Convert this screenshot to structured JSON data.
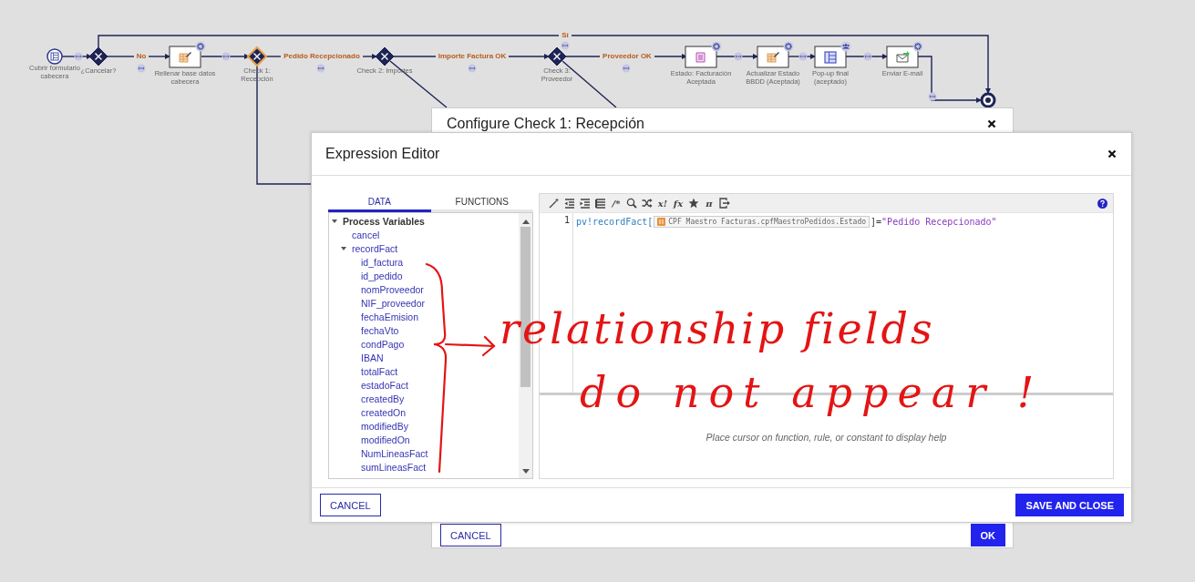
{
  "diagram": {
    "nodes": [
      {
        "kind": "start",
        "label": [
          "Cubrir formulario",
          "cabecera"
        ],
        "selected": false
      },
      {
        "kind": "gateway",
        "label": [
          "¿Cancelar?"
        ],
        "selected": false
      },
      {
        "kind": "task",
        "label": [
          "Rellenar base datos",
          "cabecera"
        ],
        "selected": false
      },
      {
        "kind": "gateway",
        "label": [
          "Check 1:",
          "Recepción"
        ],
        "selected": true
      },
      {
        "kind": "gateway",
        "label": [
          "Check 2: Importes"
        ],
        "selected": false
      },
      {
        "kind": "gateway",
        "label": [
          "Check 3:",
          "Proveedor"
        ],
        "selected": false
      },
      {
        "kind": "task",
        "label": [
          "Estado: Facturación",
          "Aceptada"
        ],
        "selected": false
      },
      {
        "kind": "task",
        "label": [
          "Actualizar Estado",
          "BBDD (Aceptada)"
        ],
        "selected": false
      },
      {
        "kind": "task",
        "label": [
          "Pop-up final",
          "(aceptado)"
        ],
        "selected": false
      },
      {
        "kind": "task",
        "label": [
          "Enviar E-mail"
        ],
        "selected": false
      },
      {
        "kind": "end",
        "selected": false
      }
    ],
    "flow_labels": [
      "Sí",
      "No",
      "Pedido Recepcionado",
      "Importe Factura OK",
      "Proveedor OK"
    ]
  },
  "configure_dialog": {
    "title": "Configure Check 1: Recepción",
    "buttons": [
      {
        "kind": "secondary",
        "label": "CANCEL"
      },
      {
        "kind": "primary",
        "label": "OK"
      }
    ]
  },
  "expression_editor": {
    "title": "Expression Editor",
    "tabs": [
      {
        "label": "DATA",
        "selected": true
      },
      {
        "label": "FUNCTIONS",
        "selected": false
      }
    ],
    "tree": [
      {
        "label": "Process Variables",
        "expanded": true,
        "children": [
          {
            "label": "cancel"
          },
          {
            "label": "recordFact",
            "expanded": true,
            "children": [
              {
                "label": "id_factura"
              },
              {
                "label": "id_pedido"
              },
              {
                "label": "nomProveedor"
              },
              {
                "label": "NIF_proveedor"
              },
              {
                "label": "fechaEmision"
              },
              {
                "label": "fechaVto"
              },
              {
                "label": "condPago"
              },
              {
                "label": "IBAN"
              },
              {
                "label": "totalFact"
              },
              {
                "label": "estadoFact"
              },
              {
                "label": "createdBy"
              },
              {
                "label": "createdOn"
              },
              {
                "label": "modifiedBy"
              },
              {
                "label": "modifiedOn"
              },
              {
                "label": "NumLineasFact"
              },
              {
                "label": "sumLineasFact"
              }
            ]
          }
        ]
      }
    ],
    "toolbar": [
      {
        "kind": "wand"
      },
      {
        "kind": "outdent"
      },
      {
        "kind": "indent"
      },
      {
        "kind": "list"
      },
      {
        "kind": "glyph",
        "text": "/*"
      },
      {
        "kind": "search"
      },
      {
        "kind": "shuffle"
      },
      {
        "kind": "glyph",
        "text": "x!"
      },
      {
        "kind": "glyph",
        "text": "fx"
      },
      {
        "kind": "star"
      },
      {
        "kind": "glyph",
        "text": "π"
      },
      {
        "kind": "exit"
      }
    ],
    "code": {
      "line_number": "1",
      "parts": [
        {
          "kind": "variable",
          "text": "pv!recordFact["
        },
        {
          "kind": "record-chip",
          "text": "CPF Maestro Facturas.cpfMaestroPedidos.Estado"
        },
        {
          "kind": "operator",
          "text": "]="
        },
        {
          "kind": "string",
          "text": "\"Pedido Recepcionado\""
        }
      ]
    },
    "help_text": "Place cursor on function, rule, or constant to display help",
    "buttons": [
      {
        "kind": "secondary",
        "label": "CANCEL"
      },
      {
        "kind": "primary",
        "label": "SAVE AND CLOSE"
      }
    ]
  },
  "annotation": {
    "lines": [
      "relationship fields",
      "do not appear !"
    ]
  }
}
